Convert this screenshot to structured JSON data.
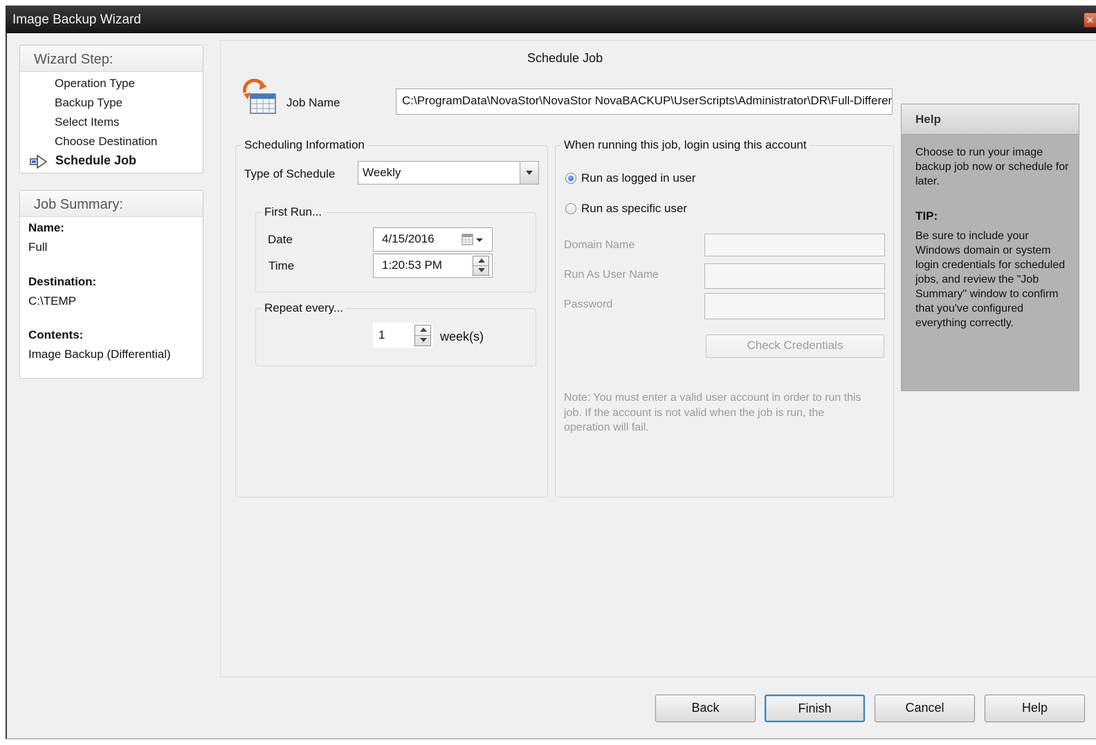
{
  "window": {
    "title": "Image Backup Wizard",
    "close_glyph": "✕"
  },
  "wizard_steps": {
    "title": "Wizard Step:",
    "items": [
      {
        "label": "Operation Type"
      },
      {
        "label": "Backup Type"
      },
      {
        "label": "Select Items"
      },
      {
        "label": "Choose Destination"
      },
      {
        "label": "Schedule Job",
        "active": true
      }
    ]
  },
  "job_summary": {
    "title": "Job Summary:",
    "name_label": "Name:",
    "name_value": "Full",
    "destination_label": "Destination:",
    "destination_value": "C:\\TEMP",
    "contents_label": "Contents:",
    "contents_value": "Image Backup (Differential)"
  },
  "main": {
    "title": "Schedule Job",
    "job_name_label": "Job Name",
    "job_name_value": "C:\\ProgramData\\NovaStor\\NovaStor NovaBACKUP\\UserScripts\\Administrator\\DR\\Full-Differential",
    "scheduling": {
      "group_label": "Scheduling Information",
      "type_label": "Type of Schedule",
      "type_value": "Weekly",
      "first_run": {
        "group_label": "First Run...",
        "date_label": "Date",
        "date_value": "4/15/2016",
        "time_label": "Time",
        "time_value": "1:20:53 PM"
      },
      "repeat": {
        "group_label": "Repeat every...",
        "value": "1",
        "unit": "week(s)"
      }
    },
    "login": {
      "group_label": "When running this job, login using this account",
      "option_logged_in": "Run as logged in user",
      "option_specific": "Run as specific user",
      "selected": "logged_in",
      "domain_label": "Domain Name",
      "domain_value": "",
      "user_label": "Run As User Name",
      "user_value": "",
      "password_label": "Password",
      "password_value": "",
      "check_button": "Check Credentials",
      "note": "Note: You must enter a valid user account in order to run this job. If the account is not valid when the job is run, the operation will fail."
    }
  },
  "help": {
    "title": "Help",
    "text": "Choose to run your image backup job now or schedule for later.",
    "tip_label": "TIP:",
    "tip_text": "Be sure to include your Windows domain or system login credentials for scheduled jobs, and review the \"Job Summary\" window to confirm that you've configured everything correctly."
  },
  "buttons": {
    "back": "Back",
    "finish": "Finish",
    "cancel": "Cancel",
    "help": "Help"
  },
  "colors": {
    "titlebar": "#1f1f1f",
    "help_bg": "#b3b3b3",
    "accent": "#3c7fb1"
  },
  "icons": [
    "schedule-calendar-icon",
    "current-step-arrow-icon",
    "dropdown-arrow-icon",
    "calendar-picker-icon",
    "spin-up-icon",
    "spin-down-icon"
  ]
}
